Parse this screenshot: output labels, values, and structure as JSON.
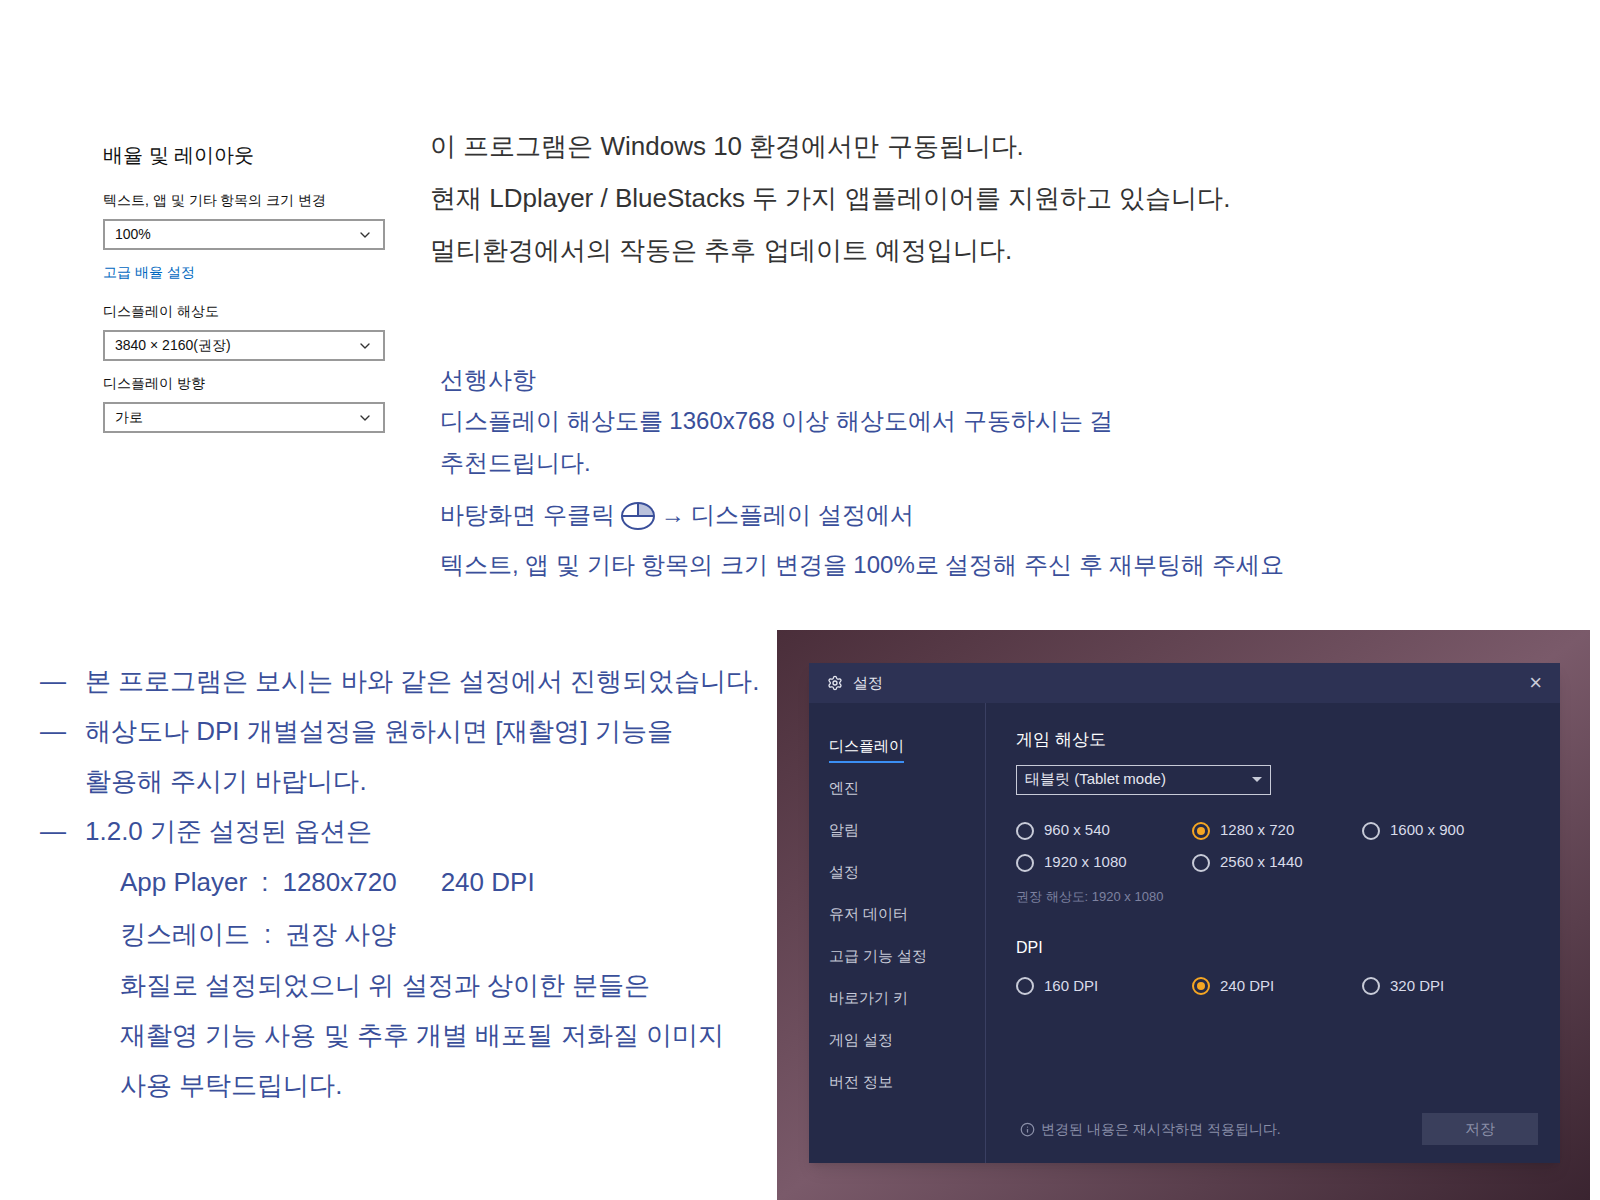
{
  "display_settings": {
    "heading": "배율 및 레이아웃",
    "items": [
      {
        "kind": "field",
        "label": "텍스트, 앱 및 기타 항목의 크기 변경",
        "value": "100%"
      },
      {
        "kind": "link",
        "label": "고급 배율 설정"
      },
      {
        "kind": "field",
        "label": "디스플레이 해상도",
        "value": "3840 × 2160(권장)"
      },
      {
        "kind": "field",
        "label": "디스플레이 방향",
        "value": "가로"
      }
    ]
  },
  "notes_top": [
    "이 프로그램은 Windows 10 환경에서만 구동됩니다.",
    "현재 LDplayer / BlueStacks 두 가지 앱플레이어를 지원하고 있습니다.",
    "멀티환경에서의 작동은 추후 업데이트 예정입니다."
  ],
  "prerequisites": {
    "title": "선행사항",
    "lines": [
      "디스플레이 해상도를 1360x768 이상 해상도에서 구동하시는 걸",
      "추천드립니다."
    ],
    "step": {
      "before": "바탕화면 우클릭",
      "after": "→ 디스플레이 설정에서"
    },
    "last": "텍스트, 앱 및 기타 항목의 크기 변경을 100%로 설정해 주신 후 재부팅해 주세요"
  },
  "notes_bottom": [
    {
      "bullet": "—",
      "lines": [
        "본 프로그램은 보시는 바와 같은 설정에서 진행되었습니다."
      ]
    },
    {
      "bullet": "—",
      "lines": [
        "해상도나 DPI 개별설정을 원하시면 [재촬영] 기능을",
        "활용해 주시기 바랍니다."
      ]
    },
    {
      "bullet": "—",
      "lines": [
        "1.2.0 기준 설정된 옵션은"
      ]
    }
  ],
  "options": [
    {
      "name": "App Player",
      "sep": ":",
      "value": "1280x720",
      "extra": "240 DPI"
    },
    {
      "name": "킹스레이드",
      "sep": ":",
      "value": "권장 사양",
      "extra": ""
    }
  ],
  "notes_tail": [
    "화질로 설정되었으니 위 설정과 상이한 분들은",
    "재촬영 기능 사용 및 추후 개별 배포될 저화질 이미지",
    "사용 부탁드립니다."
  ],
  "dialog": {
    "title": "설정",
    "close": "×",
    "sidebar": [
      {
        "label": "디스플레이",
        "selected": true
      },
      {
        "label": "엔진",
        "selected": false
      },
      {
        "label": "알림",
        "selected": false
      },
      {
        "label": "설정",
        "selected": false
      },
      {
        "label": "유저 데이터",
        "selected": false
      },
      {
        "label": "고급 기능 설정",
        "selected": false
      },
      {
        "label": "바로가기 키",
        "selected": false
      },
      {
        "label": "게임 설정",
        "selected": false
      },
      {
        "label": "버전 정보",
        "selected": false
      }
    ],
    "resolution_title": "게임 해상도",
    "mode": "태블릿 (Tablet mode)",
    "resolutions": [
      {
        "label": "960 x 540",
        "selected": false
      },
      {
        "label": "1280 x 720",
        "selected": true
      },
      {
        "label": "1600 x 900",
        "selected": false
      },
      {
        "label": "1920 x 1080",
        "selected": false
      },
      {
        "label": "2560 x 1440",
        "selected": false
      }
    ],
    "recommended": "권장 해상도: 1920 x 1080",
    "dpi_title": "DPI",
    "dpis": [
      {
        "label": "160 DPI",
        "selected": false
      },
      {
        "label": "240 DPI",
        "selected": true
      },
      {
        "label": "320 DPI",
        "selected": false
      }
    ],
    "footer_note": "변경된 내용은 재시작하면 적용됩니다.",
    "save": {
      "label": "저장",
      "disabled": true
    }
  }
}
